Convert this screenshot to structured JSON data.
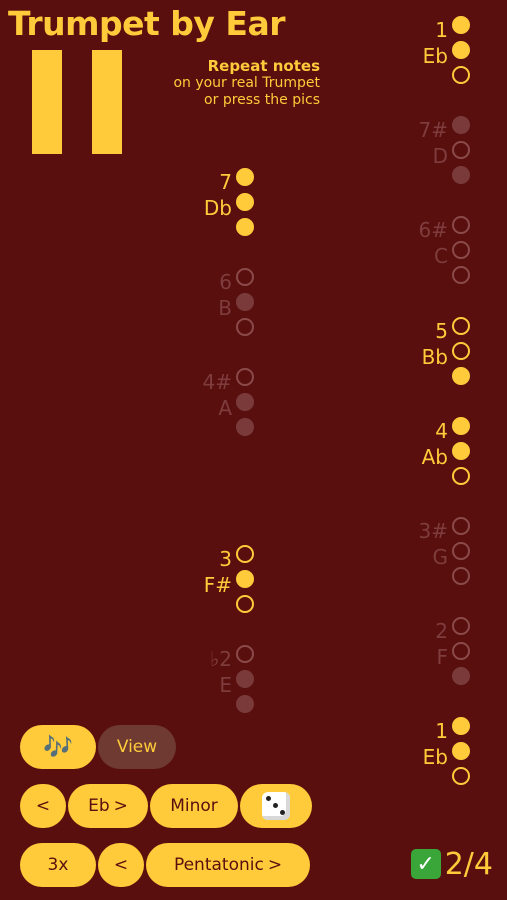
{
  "app": {
    "title": "Trumpet by Ear",
    "instruction_heading": "Repeat notes",
    "instruction_line1": "on your real Trumpet",
    "instruction_line2": "or press the pics"
  },
  "colors": {
    "background": "#5a0f0f",
    "accent": "#ffcb3a",
    "dim": "#7e3c3c"
  },
  "notes_left": [
    {
      "num": "7",
      "name": "Db",
      "valves": [
        1,
        1,
        1
      ],
      "active": true
    },
    {
      "num": "6",
      "name": "B",
      "valves": [
        0,
        1,
        0
      ],
      "active": false
    },
    {
      "num": "4#",
      "name": "A",
      "valves": [
        0,
        1,
        1
      ],
      "active": false
    },
    {
      "num": "3",
      "name": "F#",
      "valves": [
        0,
        1,
        0
      ],
      "active": true
    },
    {
      "num": "♭2",
      "name": "E",
      "valves": [
        0,
        1,
        1
      ],
      "active": false
    }
  ],
  "notes_right": [
    {
      "num": "1",
      "name": "Eb",
      "valves": [
        1,
        1,
        0
      ],
      "active": true
    },
    {
      "num": "7#",
      "name": "D",
      "valves": [
        1,
        0,
        1
      ],
      "active": false
    },
    {
      "num": "6#",
      "name": "C",
      "valves": [
        0,
        0,
        0
      ],
      "active": false
    },
    {
      "num": "5",
      "name": "Bb",
      "valves": [
        0,
        0,
        1
      ],
      "active": true
    },
    {
      "num": "4",
      "name": "Ab",
      "valves": [
        1,
        1,
        0
      ],
      "active": true
    },
    {
      "num": "3#",
      "name": "G",
      "valves": [
        0,
        0,
        0
      ],
      "active": false
    },
    {
      "num": "2",
      "name": "F",
      "valves": [
        0,
        0,
        1
      ],
      "active": false
    },
    {
      "num": "1",
      "name": "Eb",
      "valves": [
        1,
        1,
        0
      ],
      "active": true
    }
  ],
  "controls": {
    "notes_icon": "🎶",
    "view_label": "View",
    "prev_key": "<",
    "key_label": "Eb",
    "key_next": ">",
    "mode_label": "Minor",
    "dice_icon": "dice-icon",
    "repeat_label": "3x",
    "prev_scale": "<",
    "scale_label": "Pentatonic",
    "scale_next": ">"
  },
  "score": {
    "check": "✓",
    "value": "2/4"
  }
}
